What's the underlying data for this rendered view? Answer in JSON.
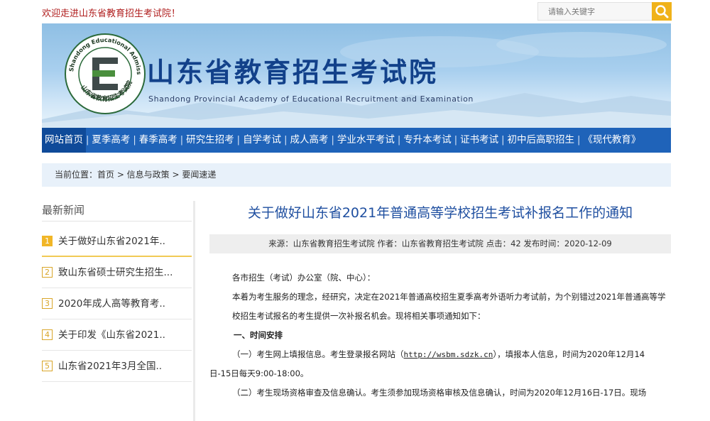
{
  "topbar": {
    "welcome": "欢迎走进山东省教育招生考试院！",
    "search_placeholder": "请输入关键字"
  },
  "banner": {
    "title": "山东省教育招生考试院",
    "subtitle": "Shandong Provincial Academy of Educational Recruitment and Examination",
    "logo_ring_text": "Shandong Educational Admission & Examinations",
    "logo_bottom_text": "山东省教育招生考试院",
    "logo_letter": "E"
  },
  "nav": {
    "items": [
      {
        "label": "网站首页",
        "active": true
      },
      {
        "label": "夏季高考"
      },
      {
        "label": "春季高考"
      },
      {
        "label": "研究生招考"
      },
      {
        "label": "自学考试"
      },
      {
        "label": "成人高考"
      },
      {
        "label": "学业水平考试"
      },
      {
        "label": "专升本考试"
      },
      {
        "label": "证书考试"
      },
      {
        "label": "初中后高职招生"
      },
      {
        "label": "《现代教育》"
      }
    ]
  },
  "breadcrumb": {
    "text": "当前位置：首页 > 信息与政策 > 要闻速递"
  },
  "sidebar": {
    "title": "最新新闻",
    "items": [
      {
        "num": "1",
        "label": "关于做好山东省2021年.."
      },
      {
        "num": "2",
        "label": "致山东省硕士研究生招生..."
      },
      {
        "num": "3",
        "label": "2020年成人高等教育考.."
      },
      {
        "num": "4",
        "label": "关于印发《山东省2021.."
      },
      {
        "num": "5",
        "label": "山东省2021年3月全国.."
      }
    ]
  },
  "article": {
    "title": "关于做好山东省2021年普通高等学校招生考试补报名工作的通知",
    "meta": "来源：山东省教育招生考试院 作者：山东省教育招生考试院 点击：42 发布时间：2020-12-09",
    "greeting": "各市招生（考试）办公室（院、中心）：",
    "para1": "本着为考生服务的理念，经研究，决定在2021年普通高校招生夏季高考外语听力考试前，为个别错过2021年普通高等学校招生考试报名的考生提供一次补报名机会。现将相关事项通知如下：",
    "section1": "一、时间安排",
    "item1_pre": "（一）考生网上填报信息。考生登录报名网站（",
    "item1_link": "http://wsbm.sdzk.cn",
    "item1_post": "），填报本人信息，时间为2020年12月14",
    "item1_cont": "日-15日每天9:00-18:00。",
    "item2": "（二）考生现场资格审查及信息确认。考生须参加现场资格审核及信息确认，时间为2020年12月16日-17日。现场"
  },
  "colors": {
    "nav_bg": "#1f63b9",
    "title_blue": "#1f4fa0",
    "welcome_red": "#b01e1e",
    "accent_gold": "#f1b627"
  }
}
